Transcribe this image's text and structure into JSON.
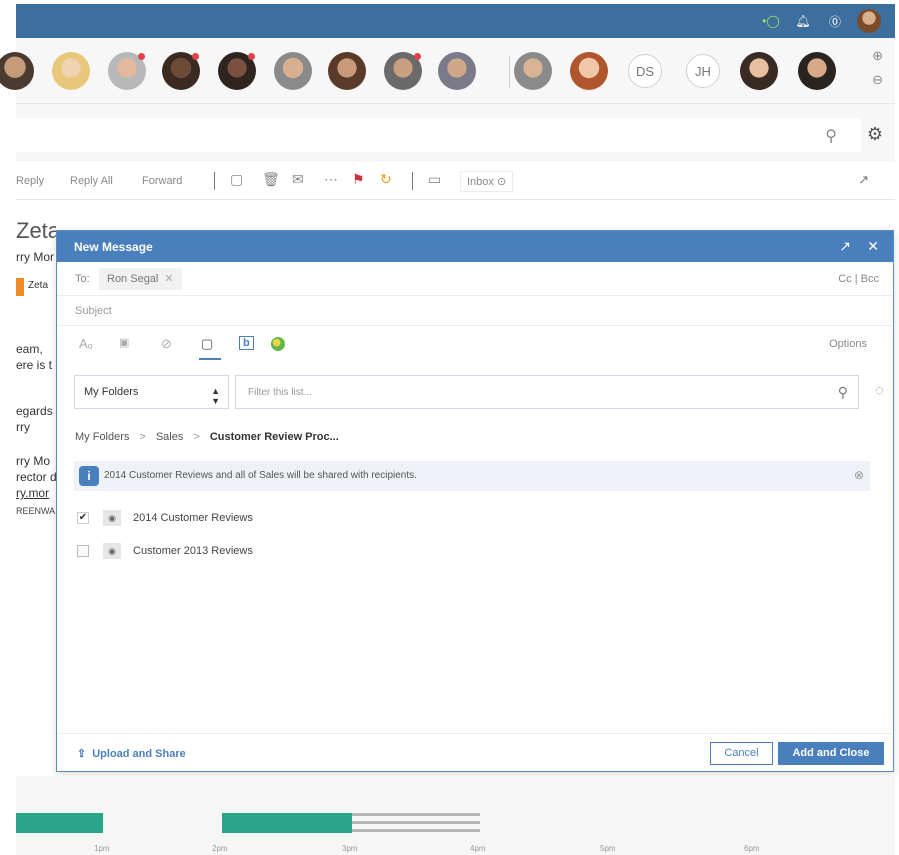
{
  "topbar": {
    "icons": [
      "status-icon",
      "bell-icon",
      "help-icon",
      "user-avatar"
    ]
  },
  "avatars": {
    "initials": [
      "DS",
      "JH"
    ]
  },
  "toolbar": {
    "reply": "Reply",
    "reply_all": "Reply All",
    "forward": "Forward",
    "inbox": "Inbox"
  },
  "background_mail": {
    "subject": "ZetaWare Board of Directors Meeting Review",
    "sender_fragment": "rry Mor",
    "org": "Zeta",
    "greeting": "eam,",
    "line2": "ere is t",
    "regards": "egards",
    "name1": "rry",
    "sig_name": "rry Mo",
    "sig_title": "rector d",
    "sig_email": "ry.mor",
    "logo_text": "REENWA"
  },
  "dialog": {
    "title": "New Message",
    "to_label": "To:",
    "recipient": "Ron Segal",
    "cc_bcc": "Cc | Bcc",
    "subject_placeholder": "Subject",
    "options": "Options",
    "folder_select": "My Folders",
    "filter_placeholder": "Filter this list...",
    "breadcrumb": [
      "My Folders",
      "Sales",
      "Customer Review Proc..."
    ],
    "info_message": "2014 Customer Reviews and all of Sales will be shared with recipients.",
    "items": [
      {
        "name": "2014 Customer Reviews",
        "checked": true
      },
      {
        "name": "Customer 2013 Reviews",
        "checked": false
      }
    ],
    "upload_label": "Upload and Share",
    "cancel_label": "Cancel",
    "add_close_label": "Add and Close"
  },
  "timeline": {
    "ticks": [
      "1pm",
      "2pm",
      "3pm",
      "4pm",
      "5pm",
      "6pm"
    ]
  },
  "colors": {
    "brand_blue": "#4a7fbe",
    "topbar": "#3d6f9e",
    "timeline_green": "#2aa58a"
  }
}
